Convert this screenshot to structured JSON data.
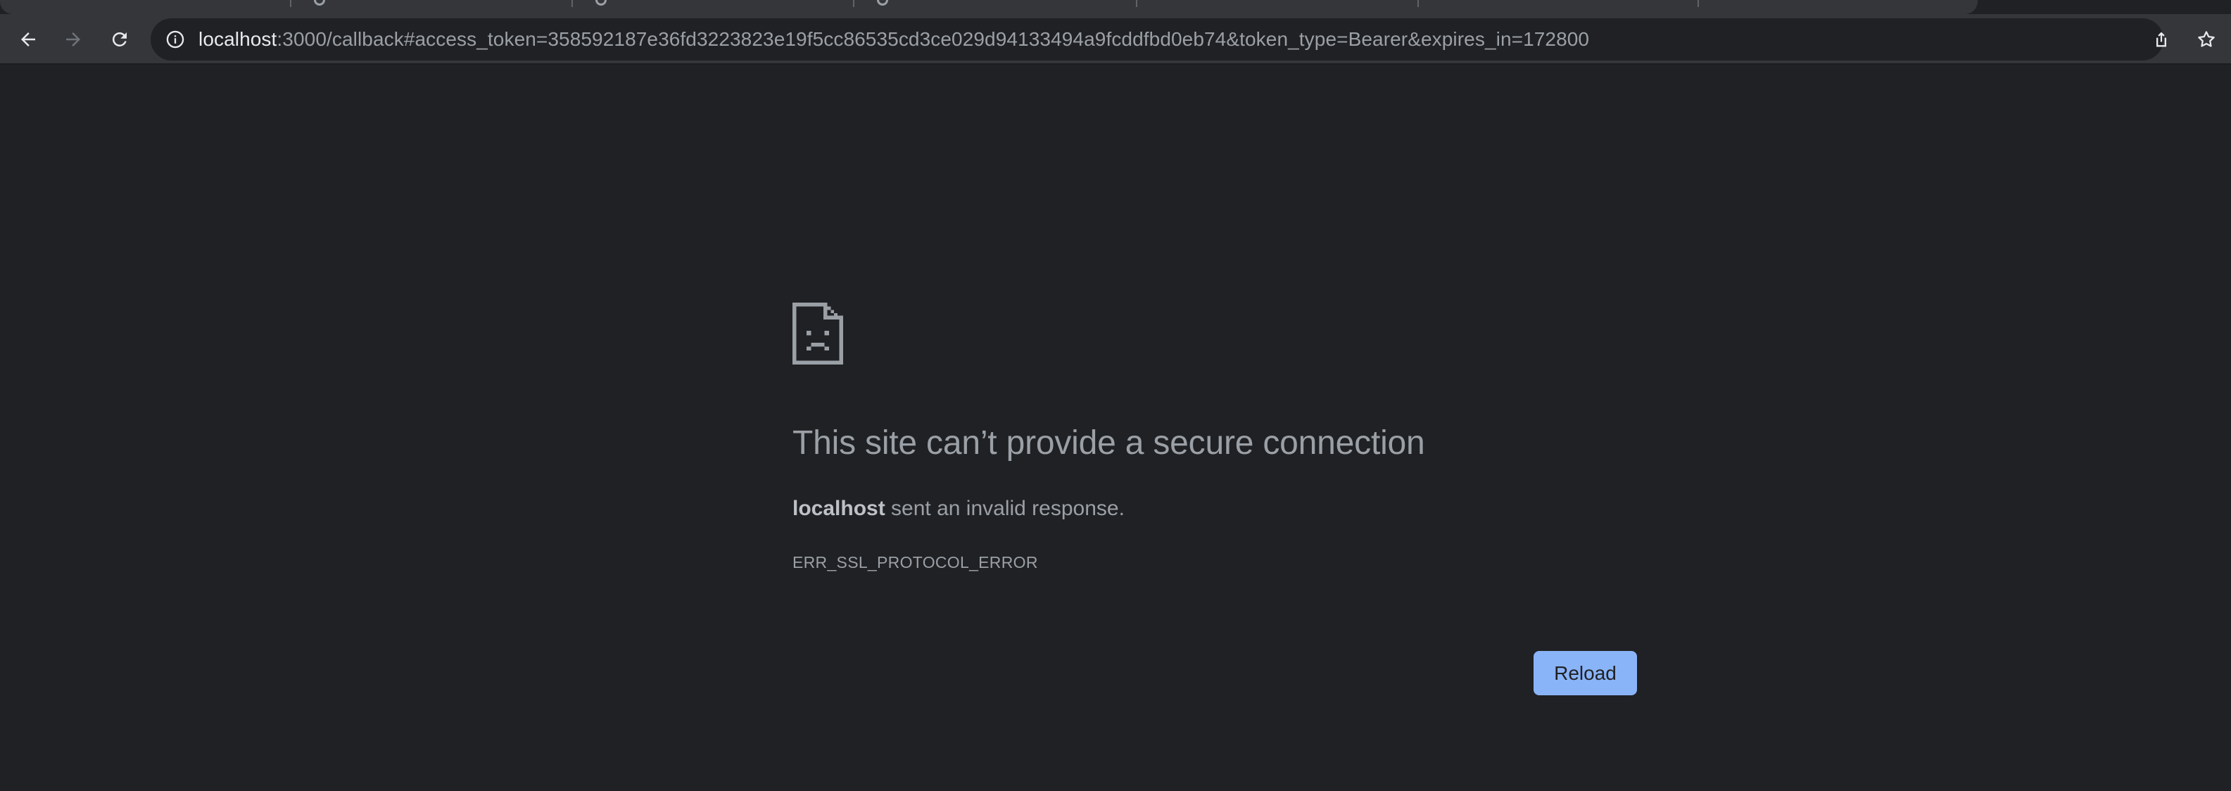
{
  "browser": {
    "tabstrip": {
      "tab_count_visible": 6
    },
    "toolbar": {
      "back_icon": "arrow-left-icon",
      "forward_icon": "arrow-right-icon",
      "reload_icon": "reload-icon",
      "forward_enabled": false
    },
    "omnibox": {
      "info_icon": "info-icon",
      "host": "localhost",
      "rest": ":3000/callback#access_token=358592187e36fd3223823e19f5cc86535cd3ce029d94133494a9fcddfbd0eb74&token_type=Bearer&expires_in=172800"
    },
    "actions": {
      "share_icon": "share-icon",
      "bookmark_icon": "star-icon"
    }
  },
  "error_page": {
    "icon": "sad-document-icon",
    "title": "This site can’t provide a secure connection",
    "host": "localhost",
    "description_suffix": " sent an invalid response.",
    "error_code": "ERR_SSL_PROTOCOL_ERROR",
    "reload_label": "Reload"
  },
  "colors": {
    "page_background": "#202124",
    "toolbar_background": "#35363a",
    "text_secondary": "#9aa0a6",
    "button_accent": "#8ab4f8"
  }
}
